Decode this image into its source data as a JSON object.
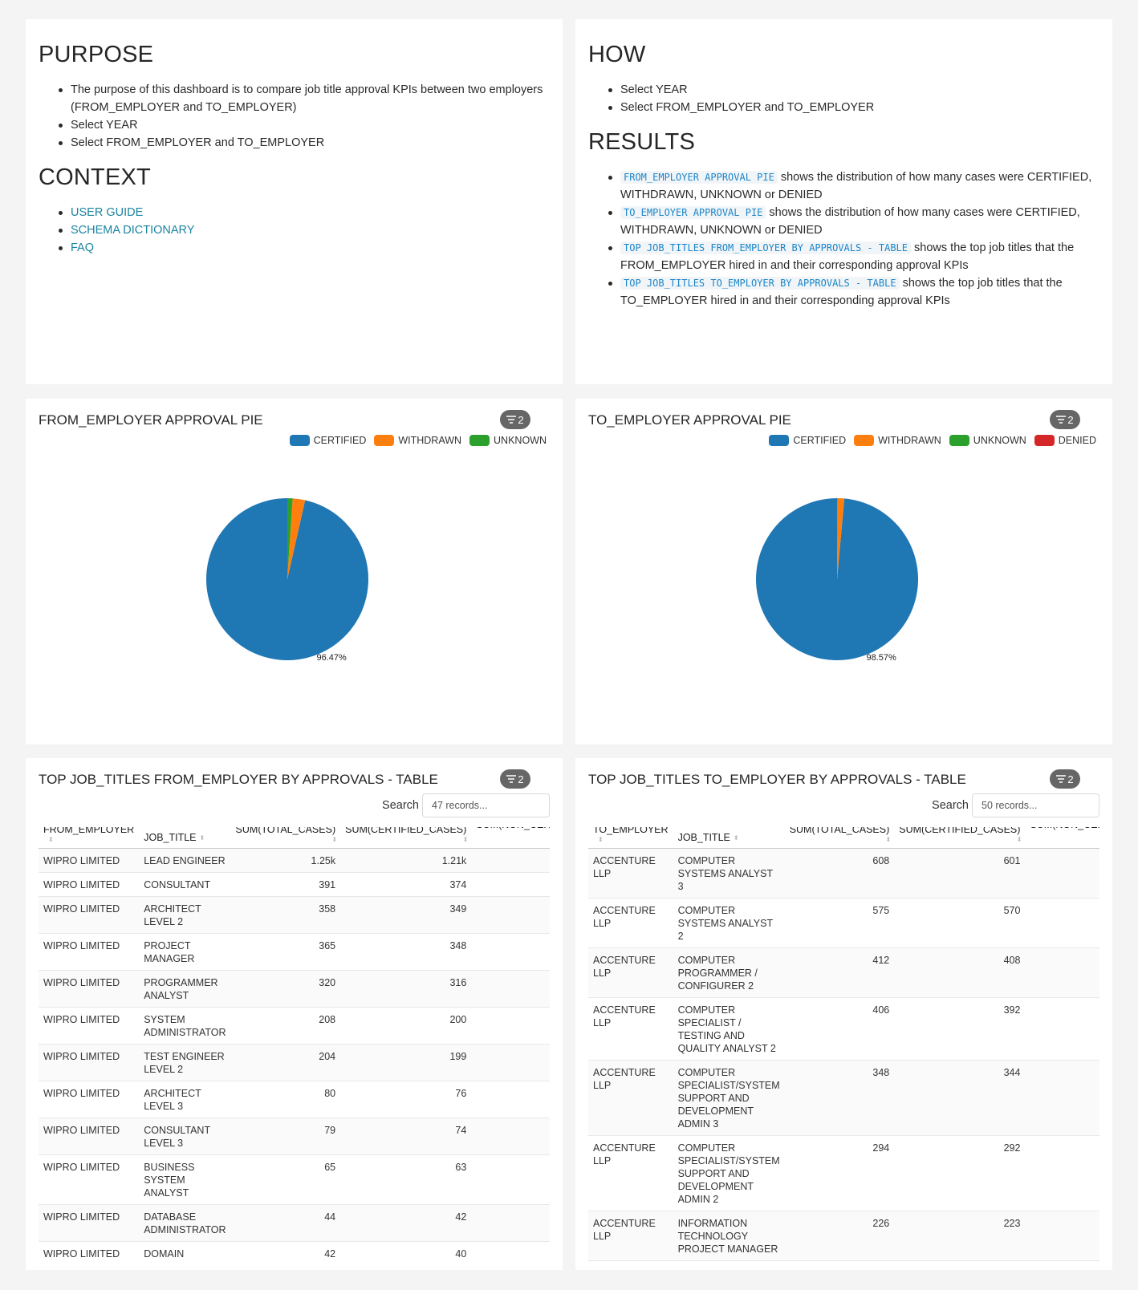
{
  "purpose": {
    "heading": "PURPOSE",
    "items": [
      "The purpose of this dashboard is to compare job title approval KPIs between two employers (FROM_EMPLOYER and TO_EMPLOYER)",
      "Select YEAR",
      "Select FROM_EMPLOYER and TO_EMPLOYER"
    ],
    "context_heading": "CONTEXT",
    "context_links": [
      "USER GUIDE",
      "SCHEMA DICTIONARY",
      "FAQ"
    ]
  },
  "how": {
    "heading": "HOW",
    "items": [
      "Select YEAR",
      "Select FROM_EMPLOYER and TO_EMPLOYER"
    ],
    "results_heading": "RESULTS",
    "results": [
      {
        "code": "FROM_EMPLOYER APPROVAL PIE",
        "text": " shows the distribution of how many cases were CERTIFIED, WITHDRAWN, UNKNOWN or DENIED"
      },
      {
        "code": "TO_EMPLOYER APPROVAL PIE",
        "text": " shows the distribution of how many cases were CERTIFIED, WITHDRAWN, UNKNOWN or DENIED"
      },
      {
        "code": "TOP JOB_TITLES FROM_EMPLOYER BY APPROVALS - TABLE",
        "text": " shows the top job titles that the FROM_EMPLOYER hired in and their corresponding approval KPIs"
      },
      {
        "code": "TOP JOB_TITLES TO_EMPLOYER BY APPROVALS - TABLE",
        "text": " shows the top job titles that the TO_EMPLOYER hired in and their corresponding approval KPIs"
      }
    ]
  },
  "pie_from": {
    "title": "FROM_EMPLOYER APPROVAL PIE",
    "filter_count": "2",
    "legend": [
      {
        "label": "CERTIFIED",
        "color": "#1f77b4"
      },
      {
        "label": "WITHDRAWN",
        "color": "#ff7f0e"
      },
      {
        "label": "UNKNOWN",
        "color": "#2ca02c"
      }
    ]
  },
  "pie_to": {
    "title": "TO_EMPLOYER APPROVAL PIE",
    "filter_count": "2",
    "legend": [
      {
        "label": "CERTIFIED",
        "color": "#1f77b4"
      },
      {
        "label": "WITHDRAWN",
        "color": "#ff7f0e"
      },
      {
        "label": "UNKNOWN",
        "color": "#2ca02c"
      },
      {
        "label": "DENIED",
        "color": "#d62728"
      }
    ]
  },
  "chart_data": [
    {
      "type": "pie",
      "title": "FROM_EMPLOYER APPROVAL PIE",
      "categories": [
        "CERTIFIED",
        "WITHDRAWN",
        "UNKNOWN"
      ],
      "values": [
        96.47,
        2.48,
        1.05
      ],
      "colors": [
        "#1f77b4",
        "#ff7f0e",
        "#2ca02c"
      ],
      "labels": [
        "96.47%",
        "",
        ""
      ],
      "legend": "top-right"
    },
    {
      "type": "pie",
      "title": "TO_EMPLOYER APPROVAL PIE",
      "categories": [
        "CERTIFIED",
        "WITHDRAWN",
        "UNKNOWN",
        "DENIED"
      ],
      "values": [
        98.57,
        1.3,
        0.08,
        0.05
      ],
      "colors": [
        "#1f77b4",
        "#ff7f0e",
        "#2ca02c",
        "#d62728"
      ],
      "labels": [
        "98.57%",
        "",
        "",
        ""
      ],
      "legend": "top-right"
    }
  ],
  "table_from": {
    "title": "TOP JOB_TITLES FROM_EMPLOYER BY APPROVALS - TABLE",
    "filter_count": "2",
    "search_label": "Search",
    "search_placeholder": "47 records...",
    "columns": [
      "FROM_EMPLOYER",
      "JOB_TITLE",
      "SUM(TOTAL_CASES)",
      "SUM(CERTIFIED_CASES)",
      "SUM(NON_CERT"
    ],
    "rows": [
      [
        "WIPRO LIMITED",
        "LEAD ENGINEER",
        "1.25k",
        "1.21k"
      ],
      [
        "WIPRO LIMITED",
        "CONSULTANT",
        "391",
        "374"
      ],
      [
        "WIPRO LIMITED",
        "ARCHITECT LEVEL 2",
        "358",
        "349"
      ],
      [
        "WIPRO LIMITED",
        "PROJECT MANAGER",
        "365",
        "348"
      ],
      [
        "WIPRO LIMITED",
        "PROGRAMMER ANALYST",
        "320",
        "316"
      ],
      [
        "WIPRO LIMITED",
        "SYSTEM ADMINISTRATOR",
        "208",
        "200"
      ],
      [
        "WIPRO LIMITED",
        "TEST ENGINEER LEVEL 2",
        "204",
        "199"
      ],
      [
        "WIPRO LIMITED",
        "ARCHITECT LEVEL 3",
        "80",
        "76"
      ],
      [
        "WIPRO LIMITED",
        "CONSULTANT LEVEL 3",
        "79",
        "74"
      ],
      [
        "WIPRO LIMITED",
        "BUSINESS SYSTEM ANALYST",
        "65",
        "63"
      ],
      [
        "WIPRO LIMITED",
        "DATABASE ADMINISTRATOR",
        "44",
        "42"
      ],
      [
        "WIPRO LIMITED",
        "DOMAIN",
        "42",
        "40"
      ]
    ]
  },
  "table_to": {
    "title": "TOP JOB_TITLES TO_EMPLOYER BY APPROVALS - TABLE",
    "filter_count": "2",
    "search_label": "Search",
    "search_placeholder": "50 records...",
    "columns": [
      "TO_EMPLOYER",
      "JOB_TITLE",
      "SUM(TOTAL_CASES)",
      "SUM(CERTIFIED_CASES)",
      "SUM(NON_CERT"
    ],
    "rows": [
      [
        "ACCENTURE LLP",
        "COMPUTER SYSTEMS ANALYST 3",
        "608",
        "601"
      ],
      [
        "ACCENTURE LLP",
        "COMPUTER SYSTEMS ANALYST 2",
        "575",
        "570"
      ],
      [
        "ACCENTURE LLP",
        "COMPUTER PROGRAMMER / CONFIGURER 2",
        "412",
        "408"
      ],
      [
        "ACCENTURE LLP",
        "COMPUTER SPECIALIST / TESTING AND QUALITY ANALYST 2",
        "406",
        "392"
      ],
      [
        "ACCENTURE LLP",
        "COMPUTER SPECIALIST/SYSTEM SUPPORT AND DEVELOPMENT ADMIN 3",
        "348",
        "344"
      ],
      [
        "ACCENTURE LLP",
        "COMPUTER SPECIALIST/SYSTEM SUPPORT AND DEVELOPMENT ADMIN 2",
        "294",
        "292"
      ],
      [
        "ACCENTURE LLP",
        "INFORMATION TECHNOLOGY PROJECT MANAGER",
        "226",
        "223"
      ]
    ]
  }
}
